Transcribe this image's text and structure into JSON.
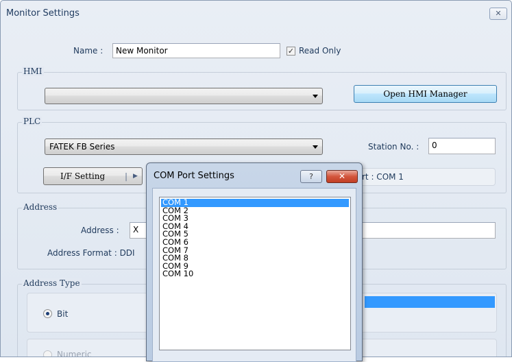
{
  "window": {
    "title": "Monitor Settings",
    "close_glyph": "✕"
  },
  "name": {
    "label": "Name :",
    "value": "New Monitor",
    "read_only_label": "Read Only",
    "read_only_checked": true
  },
  "hmi": {
    "legend": "HMI",
    "dropdown_value": "",
    "open_manager_label": "Open HMI Manager"
  },
  "plc": {
    "legend": "PLC",
    "dropdown_value": "FATEK FB Series",
    "station_label": "Station No. :",
    "station_value": "0",
    "if_setting_label": "I/F Setting",
    "port_text": "rt : COM 1"
  },
  "address": {
    "legend": "Address",
    "address_label": "Address :",
    "address_value": "X",
    "format_label": "Address Format : DDI"
  },
  "address_type": {
    "legend": "Address Type",
    "bit_label": "Bit",
    "numeric_label": "Numeric"
  },
  "com_popup": {
    "title": "COM Port Settings",
    "help_glyph": "?",
    "close_glyph": "✕",
    "selected_index": 0,
    "items": [
      "COM 1",
      "COM 2",
      "COM 3",
      "COM 4",
      "COM 5",
      "COM 6",
      "COM 7",
      "COM 8",
      "COM 9",
      "COM 10"
    ]
  }
}
